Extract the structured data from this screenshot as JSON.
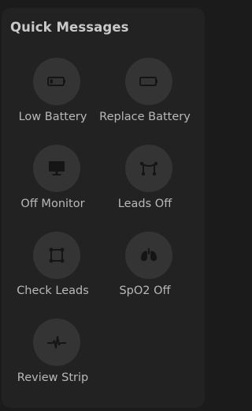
{
  "panel": {
    "title": "Quick Messages",
    "items": [
      {
        "label": "Low Battery",
        "icon": "battery-low-icon"
      },
      {
        "label": "Replace Battery",
        "icon": "battery-empty-icon"
      },
      {
        "label": "Off Monitor",
        "icon": "monitor-icon"
      },
      {
        "label": "Leads Off",
        "icon": "leads-off-icon"
      },
      {
        "label": "Check Leads",
        "icon": "check-leads-icon"
      },
      {
        "label": "SpO2 Off",
        "icon": "lungs-icon"
      },
      {
        "label": "Review Strip",
        "icon": "ecg-waveform-icon"
      }
    ]
  },
  "colors": {
    "background": "#1b1b1b",
    "panel": "#222222",
    "button": "#343434",
    "icon": "#151515",
    "title_text": "#c9c9c9",
    "label_text": "#b9b9b9"
  }
}
